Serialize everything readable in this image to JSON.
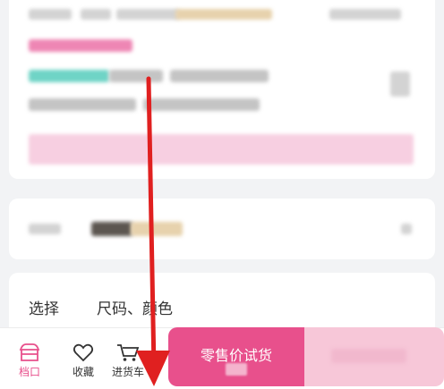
{
  "product": {
    "select_label": "选择",
    "select_value": "尺码、颜色"
  },
  "bottom_bar": {
    "shop_label": "档口",
    "favorite_label": "收藏",
    "cart_label": "进货车",
    "retail_button_label": "零售价试货"
  },
  "colors": {
    "accent": "#e8508c",
    "annotation_arrow": "#e02020"
  },
  "icons": [
    "shop-icon",
    "heart-icon",
    "cart-icon",
    "down-arrow-annotation"
  ]
}
